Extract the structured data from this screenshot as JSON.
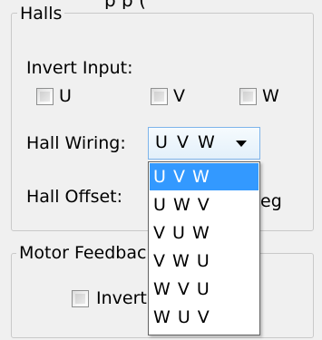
{
  "top_clipped_text": "p              p       (",
  "halls_group": {
    "legend": "Halls",
    "invert_input_label": "Invert Input:",
    "checkboxes": [
      {
        "label": "U",
        "checked": false
      },
      {
        "label": "V",
        "checked": false
      },
      {
        "label": "W",
        "checked": false
      }
    ],
    "hall_wiring_label": "Hall Wiring:",
    "hall_wiring_value": "U V W",
    "hall_offset_label": "Hall Offset:",
    "hall_offset_unit_partial": "eg"
  },
  "dropdown": {
    "options": [
      "U V W",
      "U W V",
      "V U W",
      "V W U",
      "W V U",
      "W U V"
    ],
    "selected_index": 0
  },
  "motor_group": {
    "legend_partial": "Motor Feedbac",
    "invert_checkbox_label_partial": "Invert",
    "invert_checked": false
  },
  "colors": {
    "highlight": "#3399ff",
    "combo_border": "#7eb4ea"
  }
}
